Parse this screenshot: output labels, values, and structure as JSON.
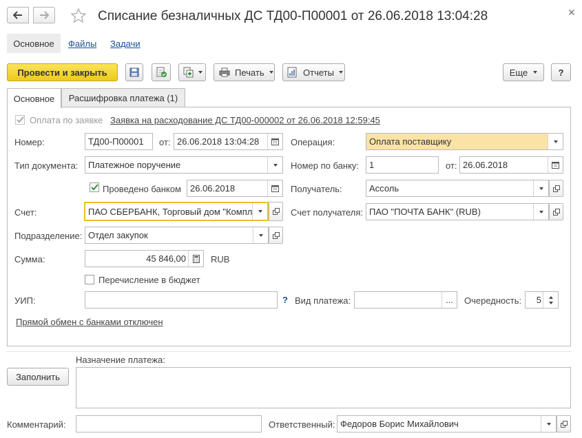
{
  "window": {
    "title": "Списание безналичных ДС ТД00-П00001 от 26.06.2018 13:04:28"
  },
  "topnav": {
    "main": "Основное",
    "files": "Файлы",
    "tasks": "Задачи"
  },
  "toolbar": {
    "post_close": "Провести и закрыть",
    "print": "Печать",
    "reports": "Отчеты",
    "more": "Еще",
    "help": "?"
  },
  "tabs": {
    "main": "Основное",
    "decoding": "Расшифровка платежа (1)"
  },
  "form": {
    "payment_by_request_label": "Оплата по заявке",
    "request_link": "Заявка на расходование ДС ТД00-000002 от 26.06.2018 12:59:45",
    "number_label": "Номер:",
    "number_value": "ТД00-П00001",
    "from_label": "от:",
    "date_value": "26.06.2018 13:04:28",
    "operation_label": "Операция:",
    "operation_value": "Оплата поставщику",
    "doc_type_label": "Тип документа:",
    "doc_type_value": "Платежное поручение",
    "bank_number_label": "Номер по банку:",
    "bank_number_value": "1",
    "bank_from_label": "от:",
    "bank_date_value": "26.06.2018",
    "processed_label": "Проведено банком",
    "processed_date": "26.06.2018",
    "recipient_label": "Получатель:",
    "recipient_value": "Ассоль",
    "account_label": "Счет:",
    "account_value": "ПАО СБЕРБАНК, Торговый дом \"Компл",
    "recipient_account_label": "Счет получателя:",
    "recipient_account_value": "ПАО \"ПОЧТА БАНК\" (RUB)",
    "department_label": "Подразделение:",
    "department_value": "Отдел закупок",
    "sum_label": "Сумма:",
    "sum_value": "45 846,00",
    "currency": "RUB",
    "budget_label": "Перечисление в бюджет",
    "uip_label": "УИП:",
    "uip_value": "",
    "question": "?",
    "payment_kind_label": "Вид платежа:",
    "payment_kind_value": "",
    "dots": "...",
    "priority_label": "Очередность:",
    "priority_value": "5",
    "direct_exchange_link": "Прямой обмен с банками отключен"
  },
  "bottom": {
    "purpose_label": "Назначение платежа:",
    "fill_button": "Заполнить",
    "comment_label": "Комментарий:",
    "comment_value": "",
    "responsible_label": "Ответственный:",
    "responsible_value": "Федоров Борис Михайлович"
  },
  "colors": {
    "accent_yellow": "#f5d630",
    "operation_bg": "#fbe3a6",
    "link": "#1c4f99",
    "focus_border": "#e8c02a"
  }
}
